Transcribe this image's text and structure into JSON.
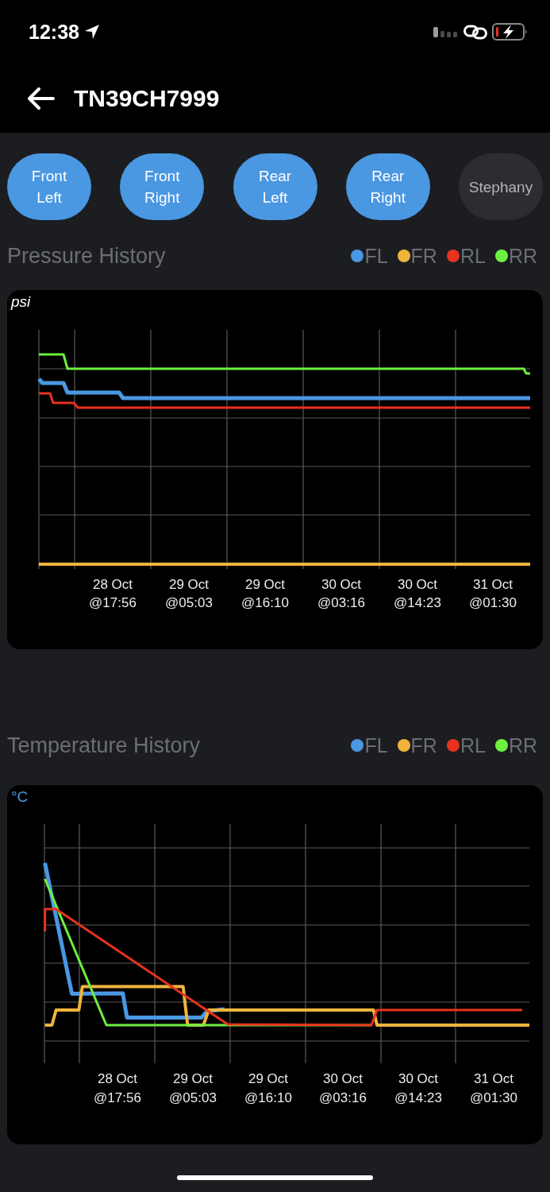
{
  "status_bar": {
    "time": "12:38"
  },
  "header": {
    "title": "TN39CH7999"
  },
  "wheel_buttons": [
    {
      "label": "Front Left",
      "selected": true
    },
    {
      "label": "Front Right",
      "selected": true
    },
    {
      "label": "Rear Left",
      "selected": true
    },
    {
      "label": "Rear Right",
      "selected": true
    },
    {
      "label": "Stephany",
      "selected": false
    }
  ],
  "pressure_history": {
    "title": "Pressure History",
    "legend": [
      {
        "label": "FL",
        "color": "#4a97e2"
      },
      {
        "label": "FR",
        "color": "#f0b43c"
      },
      {
        "label": "RL",
        "color": "#e8321f"
      },
      {
        "label": "RR",
        "color": "#6ef041"
      }
    ],
    "unit": "psi",
    "x_labels": [
      {
        "date": "28 Oct",
        "time": "@17:56"
      },
      {
        "date": "29 Oct",
        "time": "@05:03"
      },
      {
        "date": "29 Oct",
        "time": "@16:10"
      },
      {
        "date": "30 Oct",
        "time": "@03:16"
      },
      {
        "date": "30 Oct",
        "time": "@14:23"
      },
      {
        "date": "31 Oct",
        "time": "@01:30"
      }
    ]
  },
  "temperature_history": {
    "title": "Temperature History",
    "legend": [
      {
        "label": "FL",
        "color": "#4a97e2"
      },
      {
        "label": "FR",
        "color": "#f0b43c"
      },
      {
        "label": "RL",
        "color": "#e8321f"
      },
      {
        "label": "RR",
        "color": "#6ef041"
      }
    ],
    "unit": "°C",
    "x_labels": [
      {
        "date": "28 Oct",
        "time": "@17:56"
      },
      {
        "date": "29 Oct",
        "time": "@05:03"
      },
      {
        "date": "29 Oct",
        "time": "@16:10"
      },
      {
        "date": "30 Oct",
        "time": "@03:16"
      },
      {
        "date": "30 Oct",
        "time": "@14:23"
      },
      {
        "date": "31 Oct",
        "time": "@01:30"
      }
    ]
  }
}
